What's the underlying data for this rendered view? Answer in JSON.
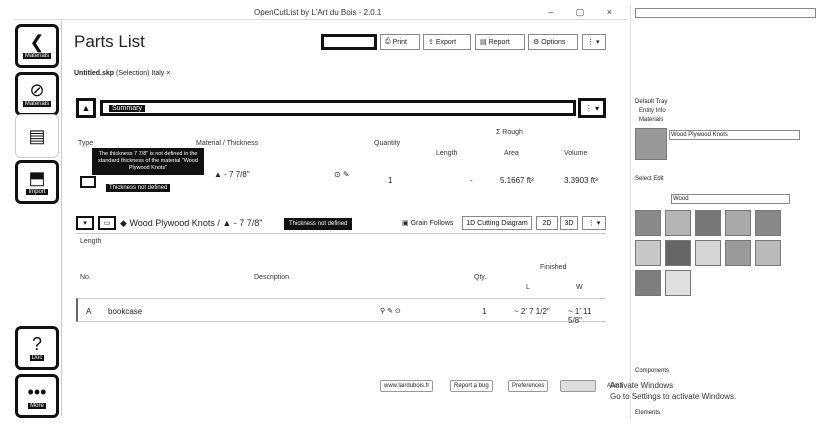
{
  "window": {
    "title": "OpenCutList by L'Art du Bois - 2.0.1",
    "controls": "– ▢ ×"
  },
  "left_nav": [
    {
      "label": "Materials",
      "icon": "chevron-left-icon"
    },
    {
      "label": "Materials",
      "icon": "check-icon"
    },
    {
      "label": "Parts",
      "icon": "list-icon"
    },
    {
      "label": "Import",
      "icon": "import-icon"
    },
    {
      "label": "Doc",
      "icon": "help-icon"
    },
    {
      "label": "More",
      "icon": "dots-icon"
    }
  ],
  "header": {
    "title": "Parts List",
    "buttons": {
      "generate": "",
      "print": "Print",
      "export": "Export",
      "report": "Report",
      "options": "Options",
      "more": "⋮ ▾"
    }
  },
  "file": {
    "name": "Untitled.skp",
    "selection": "(Selection)",
    "extra": "Italy ×"
  },
  "summary": {
    "label": "Summary",
    "caret": "⋮ ▾"
  },
  "summary_table": {
    "headers": {
      "type": "Type",
      "material": "Material / Thickness",
      "quantity": "Quantity",
      "length": "Length",
      "sum_rough": "Σ Rough",
      "area": "Area",
      "volume": "Volume"
    },
    "row": {
      "thickness": "- 7 7/8\"",
      "quantity": "1",
      "length": "-",
      "area": "5.1667 ft²",
      "volume": "3.3903 ft³"
    },
    "tooltip": "The thickness 7 7/8\" is not defined in the standard thickness of the material \"Wood Plywood Knots\"",
    "warning": "Thickness not defined"
  },
  "group": {
    "material": "Wood Plywood Knots",
    "thickness": "- 7 7/8\"",
    "warning": "Thickness not defined",
    "grain": "Grain Follows",
    "cutting_diagram": "1D Cutting Diagram",
    "diag_2d": "2D",
    "diag_3d": "3D",
    "length_label": "Length"
  },
  "parts_table": {
    "headers": {
      "num": "No.",
      "description": "Description",
      "qty": "Qty.",
      "finished": "Finished",
      "L": "L",
      "W": "W"
    },
    "rows": [
      {
        "num": "A",
        "description": "bookcase",
        "qty": "1",
        "L": "~ 2' 7 1/2\"",
        "W": "~ 1' 11 5/8\""
      }
    ]
  },
  "footer": {
    "github": "www.lairdubois.fr",
    "bug": "Report a bug",
    "prefs": "Preferences",
    "about": "About"
  },
  "right_panel": {
    "default_tray": "Default Tray",
    "entity_info": "Entity Info",
    "materials": "Materials",
    "material_name": "Wood Plywood Knots",
    "tabs": [
      "Select",
      "Edit"
    ],
    "category": "Wood",
    "components": "Components",
    "elements": "Elements"
  },
  "activate": {
    "line1": "Activate Windows",
    "line2": "Go to Settings to activate Windows."
  }
}
